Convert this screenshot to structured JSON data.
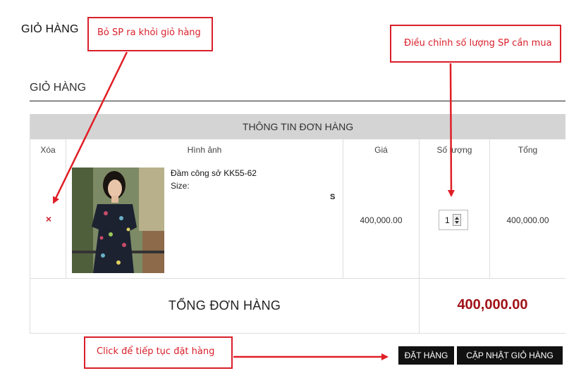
{
  "page": {
    "title": "GIỎ HÀNG"
  },
  "cart": {
    "section_title": "GIỎ HÀNG",
    "header": "THÔNG TIN ĐƠN HÀNG",
    "columns": {
      "remove": "Xóa",
      "image": "Hình ảnh",
      "price": "Giá",
      "quantity": "Số lượng",
      "total": "Tổng"
    },
    "items": [
      {
        "remove_glyph": "×",
        "image_icon": "product-photo-dress",
        "name": "Đầm công sở KK55-62",
        "size_label": "Size:",
        "size_value": "S",
        "price": "400,000.00",
        "quantity": "1",
        "line_total": "400,000.00"
      }
    ],
    "order_total_label": "TỔNG ĐƠN HÀNG",
    "order_total_value": "400,000.00"
  },
  "buttons": {
    "order": "ĐẶT HÀNG",
    "update_cart": "CẬP NHẬT GIỎ HÀNG"
  },
  "annotations": {
    "remove": "Bỏ SP ra khỏi giỏ hàng",
    "quantity": "Điều chỉnh số lượng SP cần mua",
    "continue": "Click để tiếp tục đặt hàng"
  },
  "colors": {
    "annotation_red": "#d91f2a",
    "total_red": "#a11319",
    "header_gray": "#d4d4d4",
    "button_black": "#111111"
  }
}
